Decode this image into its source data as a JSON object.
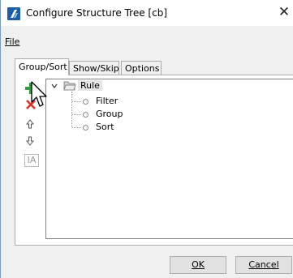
{
  "window": {
    "title": "Configure Structure Tree [cb]",
    "close_glyph": "✕"
  },
  "menu": {
    "file_label": "File"
  },
  "tabs": [
    {
      "label": "Group/Sort",
      "active": true
    },
    {
      "label": "Show/Skip",
      "active": false
    },
    {
      "label": "Options",
      "active": false
    }
  ],
  "toolbar": {
    "icons": [
      "add-icon",
      "remove-icon",
      "move-up-icon",
      "move-down-icon",
      "text-format-icon"
    ],
    "format_label": "IA"
  },
  "tree": {
    "root": {
      "label": "Rule",
      "expanded": true
    },
    "children": [
      "Filter",
      "Group",
      "Sort"
    ]
  },
  "buttons": {
    "ok_label": "OK",
    "cancel_label": "Cancel"
  },
  "colors": {
    "add_green": "#2e9e3a",
    "remove_red": "#d9342b",
    "window_border": "#7a9cc6"
  }
}
